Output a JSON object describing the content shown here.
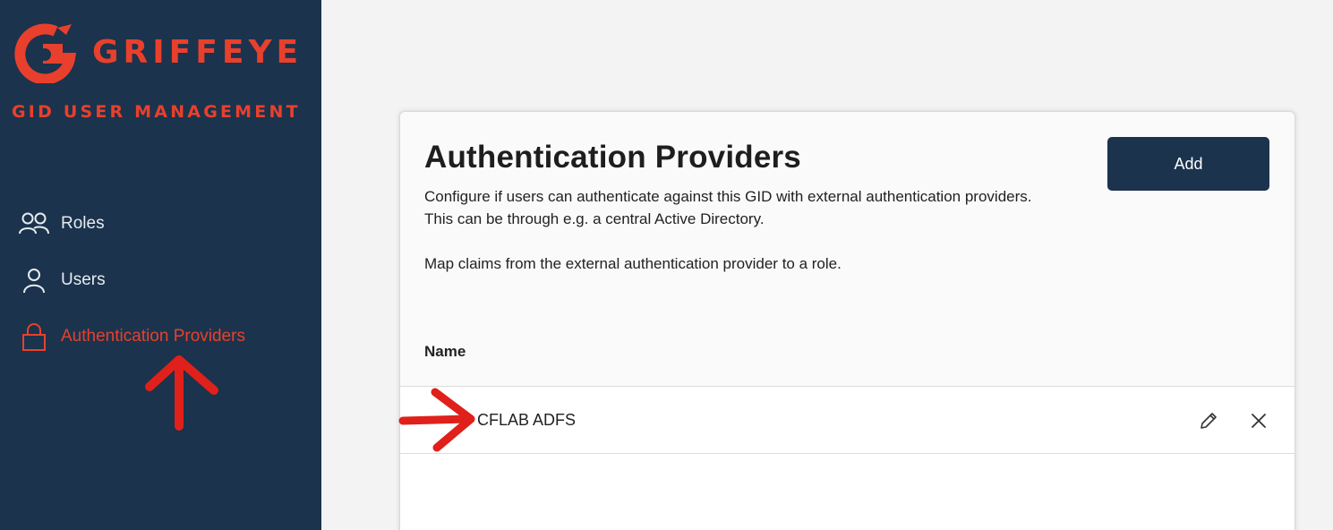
{
  "brand": {
    "name": "GRIFFEYE",
    "subtitle": "GID USER MANAGEMENT",
    "color": "#e8402d"
  },
  "sidebar": {
    "items": [
      {
        "label": "Roles",
        "icon": "users-icon",
        "active": false
      },
      {
        "label": "Users",
        "icon": "user-icon",
        "active": false
      },
      {
        "label": "Authentication Providers",
        "icon": "lock-icon",
        "active": true
      }
    ],
    "background": "#1b334c"
  },
  "main": {
    "title": "Authentication Providers",
    "description": [
      "Configure if users can authenticate against this GID with external authentication providers.",
      "This can be through e.g. a central Active Directory.",
      "Map claims from the external authentication provider to a role."
    ],
    "add_label": "Add",
    "table": {
      "columns": [
        "Name"
      ],
      "rows": [
        {
          "name": "CFLAB ADFS",
          "actions": [
            "pencil-icon",
            "close-icon"
          ]
        }
      ]
    }
  },
  "annotations": {
    "color": "#e0201a",
    "marks": [
      "up-arrow",
      "right-arrow"
    ]
  }
}
